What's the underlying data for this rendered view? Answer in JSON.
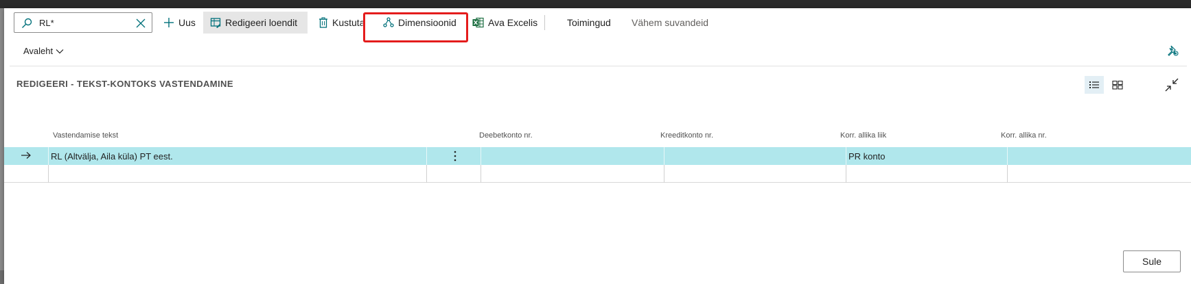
{
  "search": {
    "value": "RL*"
  },
  "actions": {
    "new": "Uus",
    "edit_list": "Redigeeri loendit",
    "delete": "Kustuta",
    "dimensions": "Dimensioonid",
    "open_excel": "Ava Excelis",
    "actions_menu": "Toimingud",
    "fewer_options": "Vähem suvandeid"
  },
  "nav": {
    "home": "Avaleht"
  },
  "page": {
    "title": "REDIGEERI - TEKST-KONTOKS VASTENDAMINE"
  },
  "table": {
    "columns": [
      "Vastendamise tekst",
      "Deebetkonto nr.",
      "Kreeditkonto nr.",
      "Korr. allika liik",
      "Korr. allika nr."
    ],
    "rows": [
      {
        "mapping_text": "RL (Altvälja, Aila küla) PT eest.",
        "debit": "",
        "credit": "",
        "bal_source_type": "PR konto",
        "bal_source_no": ""
      },
      {
        "mapping_text": "",
        "debit": "",
        "credit": "",
        "bal_source_type": "",
        "bal_source_no": ""
      }
    ]
  },
  "footer": {
    "close": "Sule"
  },
  "colors": {
    "accent": "#00707a",
    "highlight": "#e41c1c",
    "selected_row": "#b0e7ec",
    "excel_green": "#1d6f42"
  }
}
